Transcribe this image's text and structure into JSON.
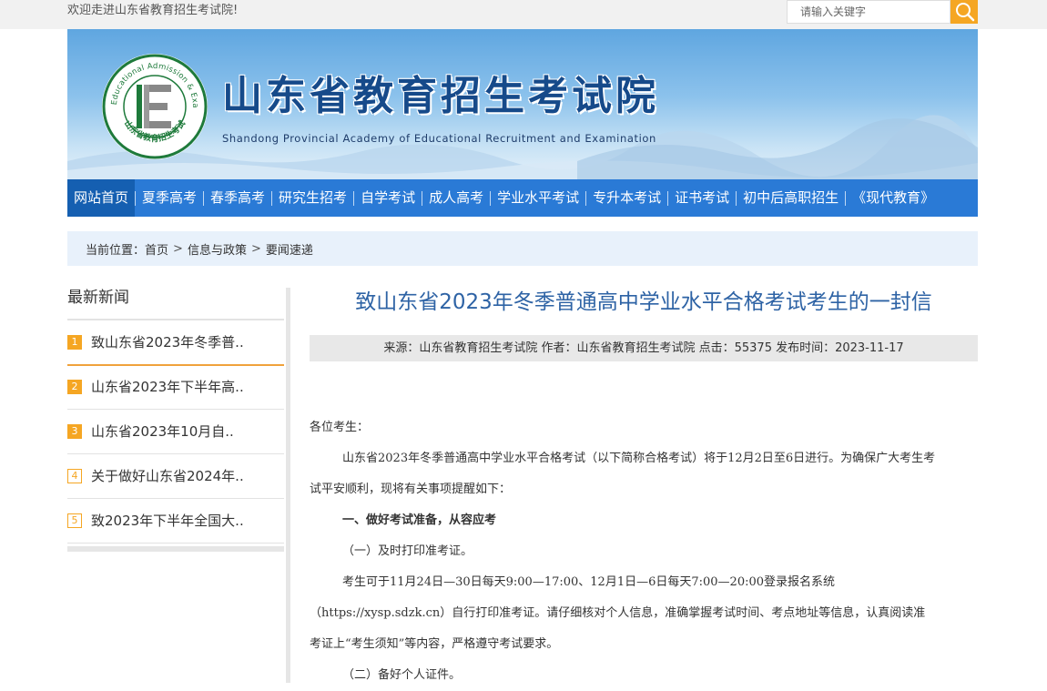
{
  "topbar": {
    "welcome": "欢迎走进山东省教育招生考试院!",
    "search_placeholder": "请输入关键字"
  },
  "banner": {
    "title": "山东省教育招生考试院",
    "subtitle": "Shandong Provincial Academy of Educational Recruitment and Examination",
    "logo_text_top": "Shandong Educational Admission & Examinations",
    "logo_text_bottom": "山东省教育招生考试"
  },
  "nav": {
    "items": [
      {
        "label": "网站首页",
        "active": true
      },
      {
        "label": "夏季高考"
      },
      {
        "label": "春季高考"
      },
      {
        "label": "研究生招考"
      },
      {
        "label": "自学考试"
      },
      {
        "label": "成人高考"
      },
      {
        "label": "学业水平考试"
      },
      {
        "label": "专升本考试"
      },
      {
        "label": "证书考试"
      },
      {
        "label": "初中后高职招生"
      },
      {
        "label": "《现代教育》"
      }
    ]
  },
  "breadcrumb": {
    "prefix": "当前位置：",
    "items": [
      "首页",
      "信息与政策",
      "要闻速递"
    ],
    "separator": ">"
  },
  "sidebar": {
    "title": "最新新闻",
    "items": [
      {
        "num": "1",
        "text": "致山东省2023年冬季普..",
        "active": true
      },
      {
        "num": "2",
        "text": "山东省2023年下半年高.."
      },
      {
        "num": "3",
        "text": "山东省2023年10月自.."
      },
      {
        "num": "4",
        "text": "关于做好山东省2024年.."
      },
      {
        "num": "5",
        "text": "致2023年下半年全国大.."
      }
    ]
  },
  "article": {
    "title": "致山东省2023年冬季普通高中学业水平合格考试考生的一封信",
    "meta": "来源：山东省教育招生考试院 作者：山东省教育招生考试院 点击：55375 发布时间：2023-11-17",
    "paragraphs": [
      "各位考生：",
      "山东省2023年冬季普通高中学业水平合格考试（以下简称合格考试）将于12月2日至6日进行。为确保广大考生考",
      "试平安顺利，现将有关事项提醒如下：",
      "一、做好考试准备，从容应考",
      "（一）及时打印准考证。",
      "考生可于11月24日—30日每天9:00—17:00、12月1日—6日每天7:00—20:00登录报名系统",
      "（https://xysp.sdzk.cn）自行打印准考证。请仔细核对个人信息，准确掌握考试时间、考点地址等信息，认真阅读准",
      "考证上“考生须知”等内容，严格遵守考试要求。",
      "（二）备好个人证件。"
    ]
  },
  "colors": {
    "nav_bg": "#2a7ad6",
    "nav_active": "#155fb1",
    "accent_orange": "#f5a623",
    "title_blue": "#2e63a5",
    "breadcrumb_bg": "#e8f1fb"
  }
}
